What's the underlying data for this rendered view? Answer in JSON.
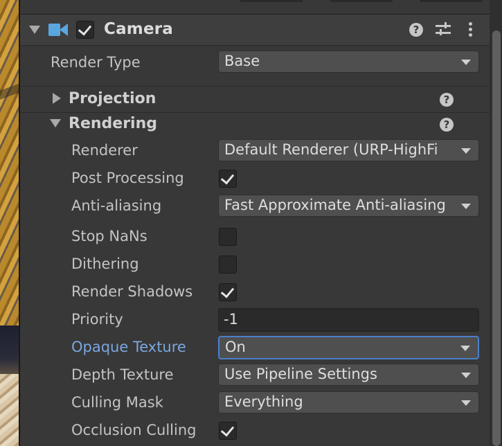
{
  "component": {
    "title": "Camera",
    "enabled": true,
    "header_icons": [
      "camera-icon",
      "help-icon",
      "preset-sliders-icon",
      "kebab-menu-icon"
    ]
  },
  "render_type": {
    "label": "Render Type",
    "value": "Base"
  },
  "sections": {
    "projection": {
      "label": "Projection",
      "expanded": false
    },
    "rendering": {
      "label": "Rendering",
      "expanded": true
    }
  },
  "rendering": {
    "renderer": {
      "label": "Renderer",
      "value": "Default Renderer (URP-HighFi"
    },
    "post_processing": {
      "label": "Post Processing",
      "checked": true
    },
    "anti_aliasing": {
      "label": "Anti-aliasing",
      "value": "Fast Approximate Anti-aliasing"
    },
    "stop_nans": {
      "label": "Stop NaNs",
      "checked": false
    },
    "dithering": {
      "label": "Dithering",
      "checked": false
    },
    "render_shadows": {
      "label": "Render Shadows",
      "checked": true
    },
    "priority": {
      "label": "Priority",
      "value": "-1"
    },
    "opaque_texture": {
      "label": "Opaque Texture",
      "value": "On"
    },
    "depth_texture": {
      "label": "Depth Texture",
      "value": "Use Pipeline Settings"
    },
    "culling_mask": {
      "label": "Culling Mask",
      "value": "Everything"
    },
    "occlusion_culling": {
      "label": "Occlusion Culling",
      "checked": true
    }
  },
  "colors": {
    "background": "#383838",
    "accent_label": "#7aa7e0",
    "focus_border": "#4c7fc9",
    "camera_icon": "#5aa7e0"
  }
}
